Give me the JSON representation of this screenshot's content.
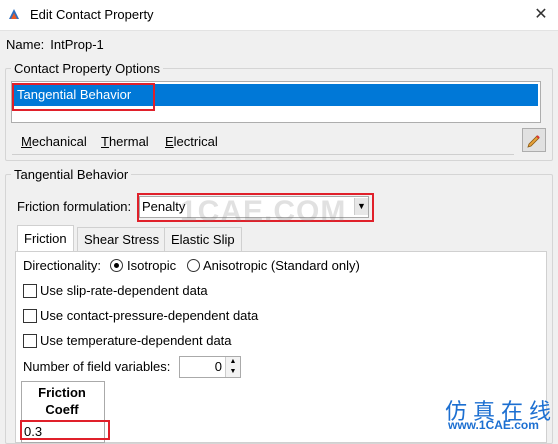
{
  "window": {
    "title": "Edit Contact Property",
    "close_glyph": "✕",
    "icon": "app-icon"
  },
  "name": {
    "label": "Name:",
    "value": "IntProp-1"
  },
  "options_group": {
    "legend": "Contact Property Options",
    "list_items": [
      "Tangential Behavior"
    ],
    "menu": [
      "Mechanical",
      "Thermal",
      "Electrical"
    ],
    "edit_icon": "pencil-icon"
  },
  "behavior_group": {
    "legend": "Tangential Behavior",
    "friction_label": "Friction formulation:",
    "friction_value": "Penalty",
    "tabs": [
      "Friction",
      "Shear Stress",
      "Elastic Slip"
    ],
    "active_tab": "Friction",
    "directionality_label": "Directionality:",
    "radio_isotropic": "Isotropic",
    "radio_anisotropic": "Anisotropic (Standard only)",
    "checkboxes": [
      "Use slip-rate-dependent data",
      "Use contact-pressure-dependent data",
      "Use temperature-dependent data"
    ],
    "field_vars_label": "Number of field variables:",
    "field_vars_value": "0",
    "table_header": "Friction Coeff",
    "table_cell": "0.3"
  },
  "watermark": {
    "text": "1CAE.COM",
    "cn": "仿真在线",
    "url": "www.1CAE.com"
  },
  "colors": {
    "selection": "#0078d7",
    "highlight_box": "#e0202a"
  }
}
